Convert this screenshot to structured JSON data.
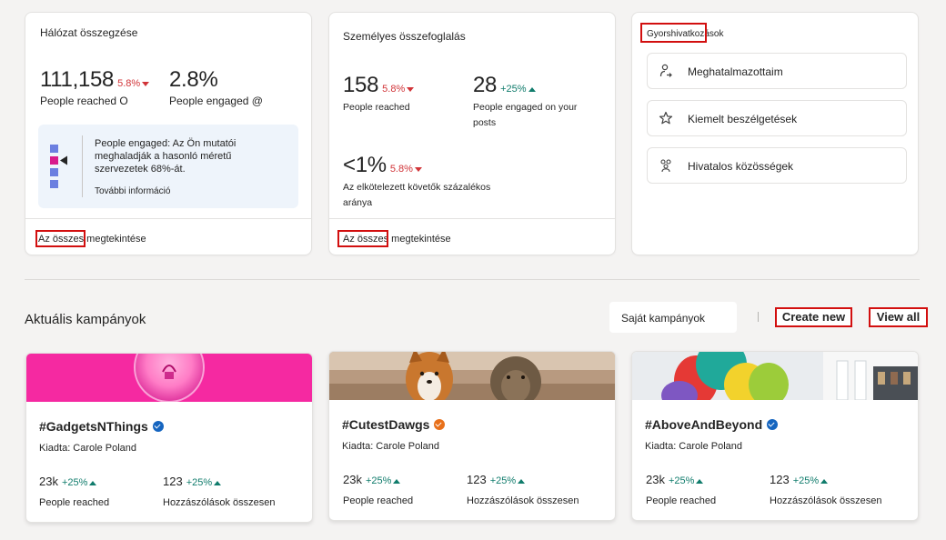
{
  "network_summary": {
    "title": "Hálózat összegzése",
    "reached_value": "111,158",
    "reached_delta": "5.8%",
    "reached_label": "People reached O",
    "engaged_value": "2.8%",
    "engaged_label": "People engaged @",
    "insight_text": "People engaged: Az Ön mutatói meghaladják a hasonló méretű szervezetek 68%-át.",
    "insight_link": "További információ",
    "footer_link": "Az összes megtekintése"
  },
  "personal_summary": {
    "title": "Személyes összefoglalás",
    "reached_value": "158",
    "reached_delta": "5.8%",
    "reached_label": "People reached",
    "engaged_value": "28",
    "engaged_delta": "+25%",
    "engaged_label": "People engaged on your posts",
    "rate_value": "<1%",
    "rate_delta": "5.8%",
    "rate_label": "Az elkötelezett követők százalékos aránya",
    "footer_link": "Az összes megtekintése"
  },
  "quick_links": {
    "title": "Gyorshivatkozások",
    "items": [
      {
        "label": "Meghatalmazottaim",
        "icon": "delegate-icon"
      },
      {
        "label": "Kiemelt beszélgetések",
        "icon": "star-icon"
      },
      {
        "label": "Hivatalos közösségek",
        "icon": "community-icon"
      }
    ]
  },
  "campaigns": {
    "section_title": "Aktuális kampányok",
    "filter_label": "Saját kampányok",
    "create_new": "Create new",
    "view_all": "View all",
    "items": [
      {
        "title": "#GadgetsNThings",
        "badge_color": "#1565c0",
        "author": "Kiadta: Carole Poland",
        "reached": "23k",
        "reached_delta": "+25%",
        "reached_label": "People reached",
        "comments": "123",
        "comments_delta": "+25%",
        "comments_label": "Hozzászólások összesen"
      },
      {
        "title": "#CutestDawgs",
        "badge_color": "#e8701a",
        "author": "Kiadta: Carole Poland",
        "reached": "23k",
        "reached_delta": "+25%",
        "reached_label": "People reached",
        "comments": "123",
        "comments_delta": "+25%",
        "comments_label": "Hozzászólások összesen"
      },
      {
        "title": "#AboveAndBeyond",
        "badge_color": "#1565c0",
        "author": "Kiadta: Carole Poland",
        "reached": "23k",
        "reached_delta": "+25%",
        "reached_label": "People reached",
        "comments": "123",
        "comments_delta": "+25%",
        "comments_label": "Hozzászólások összesen"
      }
    ]
  },
  "colors": {
    "accent_red": "#d20f0f",
    "delta_down": "#d13438",
    "delta_up": "#107c6c"
  }
}
